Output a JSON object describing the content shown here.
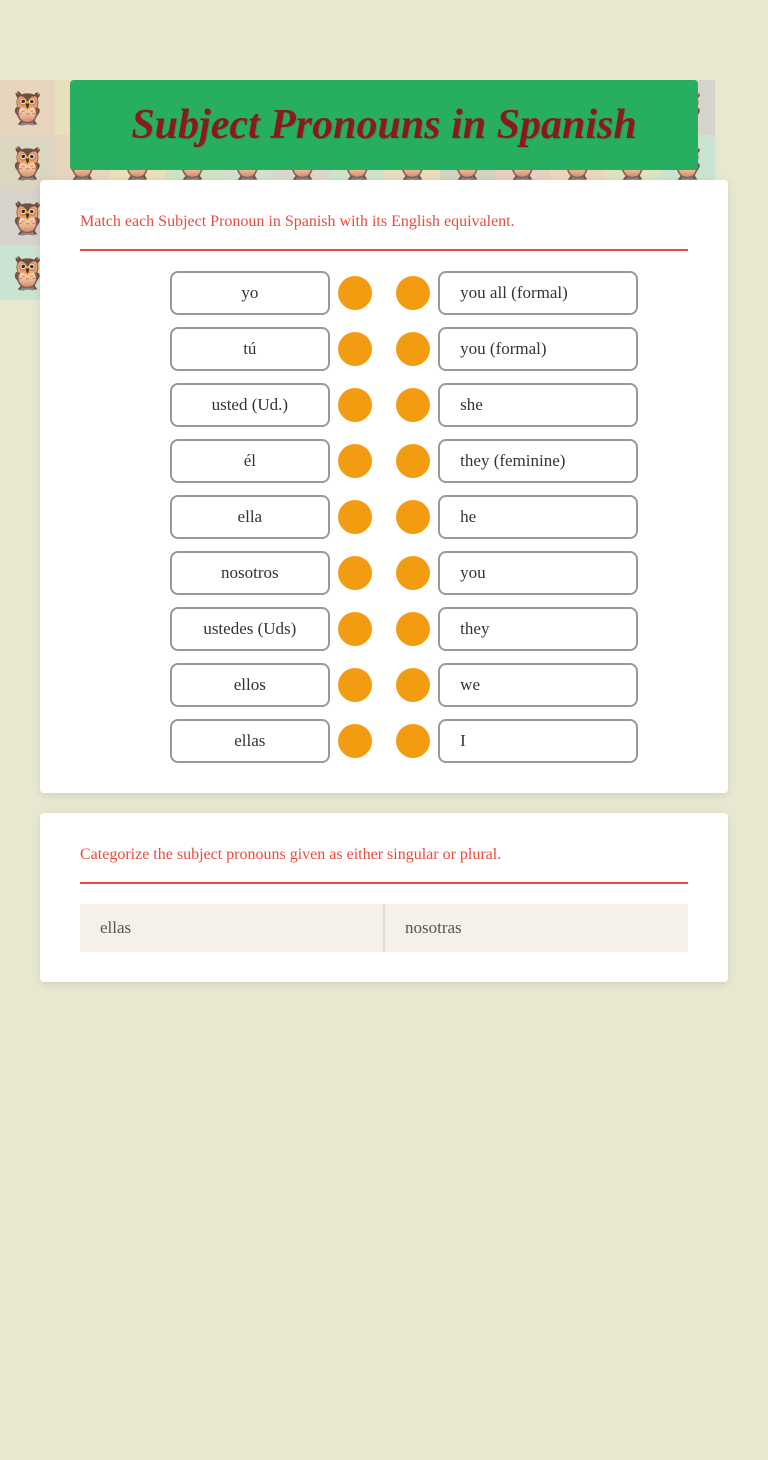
{
  "page": {
    "title": "Subject Pronouns in Spanish",
    "instructions_match": "Match each Subject Pronoun in Spanish with its English equivalent.",
    "instructions_categorize": "Categorize the subject pronouns given as either singular or plural.",
    "accent_color": "#e74c3c",
    "dot_color": "#f39c12"
  },
  "owls": [
    "🦉",
    "🦉",
    "🦉",
    "🦉",
    "🦉",
    "🦉",
    "🦉",
    "🦉",
    "🦉",
    "🦉",
    "🦉",
    "🦉",
    "🦉",
    "🦉",
    "🦉",
    "🦉",
    "🦉",
    "🦉",
    "🦉",
    "🦉",
    "🦉",
    "🦉",
    "🦉",
    "🦉",
    "🦉",
    "🦉",
    "🦉",
    "🦉",
    "🦉",
    "🦉",
    "🦉",
    "🦉",
    "🦉",
    "🦉",
    "🦉",
    "🦉",
    "🦉",
    "🦉",
    "🦉",
    "🦉",
    "🦉",
    "🦉",
    "🦉",
    "🦉",
    "🦉",
    "🦉",
    "🦉",
    "🦉",
    "🦉",
    "🦉",
    "🦉",
    "🦉",
    "🦉",
    "🦉",
    "🦉",
    "🦉"
  ],
  "match_pairs": [
    {
      "left": "yo",
      "right": "you all (formal)"
    },
    {
      "left": "tú",
      "right": "you (formal)"
    },
    {
      "left": "usted (Ud.)",
      "right": "she"
    },
    {
      "left": "él",
      "right": "they (feminine)"
    },
    {
      "left": "ella",
      "right": "he"
    },
    {
      "left": "nosotros",
      "right": "you"
    },
    {
      "left": "ustedes (Uds)",
      "right": "they"
    },
    {
      "left": "ellos",
      "right": "we"
    },
    {
      "left": "ellas",
      "right": "I"
    }
  ],
  "categorize": {
    "col1": "ellas",
    "col2": "nosotras"
  }
}
